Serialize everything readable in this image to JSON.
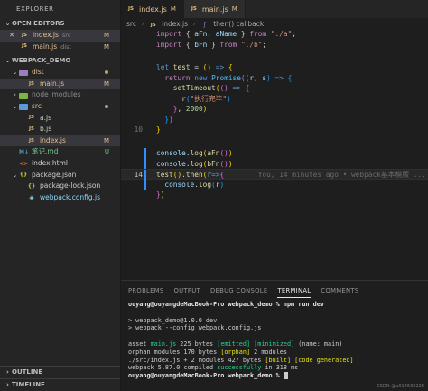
{
  "sidebar": {
    "title": "EXPLORER",
    "open_editors": {
      "header": "OPEN EDITORS",
      "items": [
        {
          "name": "index.js",
          "desc": "src",
          "badge": "M",
          "selected": true
        },
        {
          "name": "main.js",
          "desc": "dist",
          "badge": "M",
          "selected": false
        }
      ]
    },
    "project": {
      "header": "WEBPACK_DEMO",
      "items": [
        {
          "name": "dist",
          "kind": "folder",
          "depth": 1
        },
        {
          "name": "main.js",
          "kind": "js",
          "depth": 2,
          "badge": "M"
        },
        {
          "name": "node_modules",
          "kind": "folder",
          "depth": 1
        },
        {
          "name": "src",
          "kind": "folder",
          "depth": 1
        },
        {
          "name": "a.js",
          "kind": "js",
          "depth": 2
        },
        {
          "name": "b.js",
          "kind": "js",
          "depth": 2
        },
        {
          "name": "index.js",
          "kind": "js",
          "depth": 2,
          "badge": "M"
        },
        {
          "name": "笔记.md",
          "kind": "md",
          "depth": 1,
          "badge": "U"
        },
        {
          "name": "index.html",
          "kind": "html",
          "depth": 1
        },
        {
          "name": "package.json",
          "kind": "json",
          "depth": 1
        },
        {
          "name": "package-lock.json",
          "kind": "json",
          "depth": 1
        },
        {
          "name": "webpack.config.js",
          "kind": "wp",
          "depth": 1
        }
      ]
    },
    "outline": "OUTLINE",
    "timeline": "TIMELINE"
  },
  "tabs": [
    {
      "name": "index.js",
      "badge": "M",
      "active": true
    },
    {
      "name": "main.js",
      "badge": "M",
      "active": false
    }
  ],
  "breadcrumb": [
    "src",
    "index.js",
    "then() callback"
  ],
  "code": {
    "blame": "You, 14 minutes ago • webpack基本模版 ..."
  },
  "panel": {
    "tabs": [
      "PROBLEMS",
      "OUTPUT",
      "DEBUG CONSOLE",
      "TERMINAL",
      "COMMENTS"
    ],
    "active_tab": "TERMINAL",
    "terminal": {
      "prompt": "ouyang@ouyangdeMacBook-Pro webpack_demo % npm run dev",
      "script_name": "> webpack_demo@1.0.0 dev",
      "script_cmd": "> webpack --config webpack.config.js",
      "asset_prefix": "asset ",
      "asset_name": "main.js",
      "asset_size": " 225 bytes ",
      "asset_flags1": "[emitted]",
      "asset_flags2": "[minimized]",
      "asset_tail": " (name: main)",
      "orphan_prefix": "orphan modules 170 bytes ",
      "orphan_flag": "[orphan]",
      "orphan_tail": " 2 modules",
      "src_prefix": "./src/index.js + 2 modules 427 bytes ",
      "src_flag1": "[built]",
      "src_flag2": "[code generated]",
      "compiled_prefix": "webpack 5.87.0 compiled ",
      "compiled_ok": "successfully",
      "compiled_tail": " in 318 ms",
      "final_prompt": "ouyang@ouyangdeMacBook-Pro webpack_demo % "
    },
    "watermark": "CSDN @u014632228"
  }
}
